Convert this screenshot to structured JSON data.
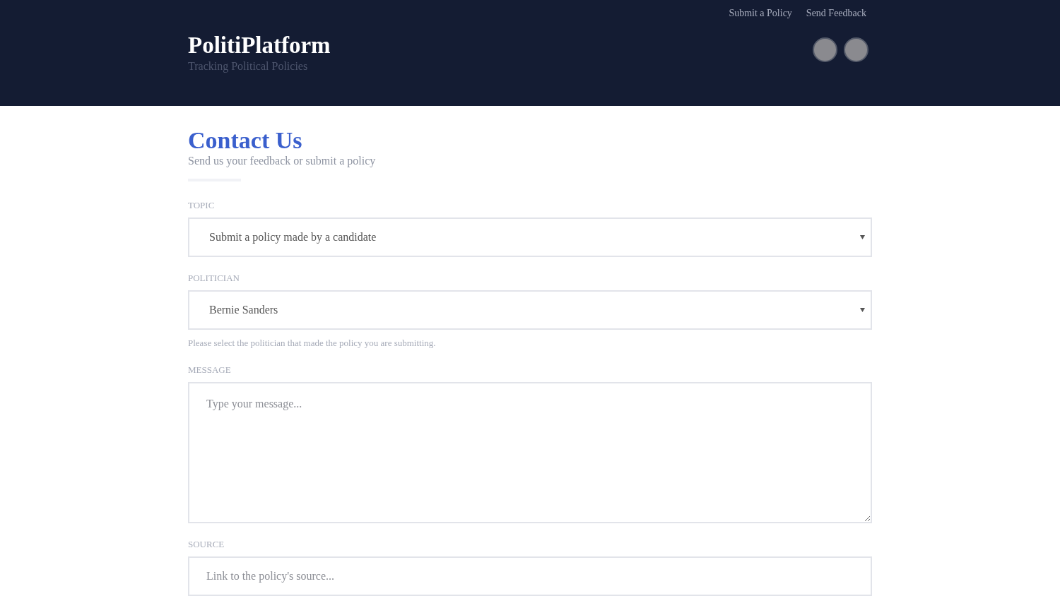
{
  "header": {
    "title": "PolitiPlatform",
    "tagline": "Tracking Political Policies",
    "nav": [
      "Submit a Policy",
      "Send Feedback"
    ]
  },
  "page": {
    "title": "Contact Us",
    "subtitle": "Send us your feedback or submit a policy"
  },
  "fields": [
    {
      "kind": "select",
      "label": "TOPIC",
      "value": "Submit a policy made by a candidate"
    },
    {
      "kind": "select",
      "label": "POLITICIAN",
      "value": "Bernie Sanders",
      "help": "Please select the politician that made the policy you are submitting."
    },
    {
      "kind": "textarea",
      "label": "MESSAGE",
      "placeholder": "Type your message..."
    },
    {
      "kind": "input",
      "label": "SOURCE",
      "placeholder": "Link to the policy's source..."
    }
  ]
}
